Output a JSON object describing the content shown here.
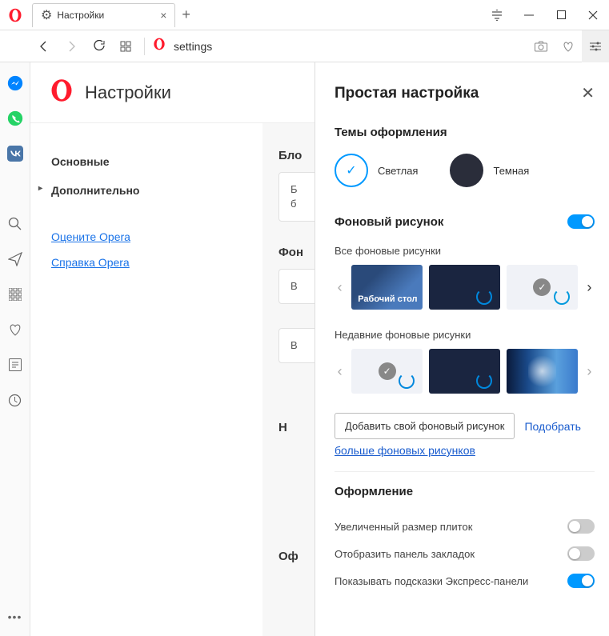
{
  "titlebar": {
    "tab_title": "Настройки"
  },
  "toolbar": {
    "address": "settings"
  },
  "settings": {
    "page_title": "Настройки",
    "nav": {
      "main": "Основные",
      "advanced": "Дополнительно",
      "rate": "Оцените Opera",
      "help": "Справка Opera"
    },
    "sections": {
      "block": "Бло",
      "wall": "Фон",
      "recent_hint": "Н",
      "design": "Оф"
    }
  },
  "panel": {
    "title": "Простая настройка",
    "themes_title": "Темы оформления",
    "theme_light": "Светлая",
    "theme_dark": "Темная",
    "wallpaper_title": "Фоновый рисунок",
    "all_wallpapers": "Все фоновые рисунки",
    "desktop_label": "Рабочий стол",
    "recent_wallpapers": "Недавние фоновые рисунки",
    "add_button": "Добавить свой фоновый рисунок",
    "pick_link": "Подобрать",
    "more_link": "больше фоновых рисунков",
    "design_title": "Оформление",
    "opts": {
      "big_tiles": "Увеличенный размер плиток",
      "bookmarks_bar": "Отобразить панель закладок",
      "speed_dial_hints": "Показывать подсказки Экспресс-панели"
    }
  }
}
